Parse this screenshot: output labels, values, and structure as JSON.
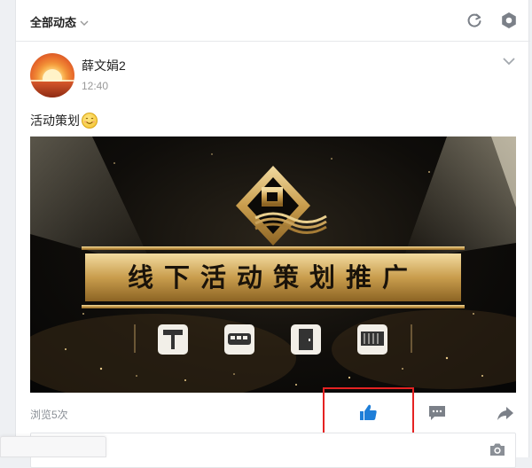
{
  "topbar": {
    "filter_label": "全部动态",
    "filter_chevron_icon": "chevron-down-icon",
    "refresh_icon": "refresh-icon",
    "settings_icon": "hexagon-gear-icon"
  },
  "post": {
    "author": "薛文娟2",
    "time": "12:40",
    "more_icon": "chevron-down-icon",
    "text": "活动策划",
    "emoji_icon": "smiley-emoji",
    "image": {
      "headline": "线下活动策划推广",
      "service_icons": [
        "billboard-icon",
        "bus-icon",
        "door-icon",
        "keyboard-icon"
      ]
    },
    "views_label": "浏览5次",
    "actions": {
      "like_icon": "thumbs-up-icon",
      "comment_icon": "comment-icon",
      "share_icon": "share-arrow-icon"
    },
    "comment_box_icon": "camera-icon"
  },
  "colors": {
    "accent_blue": "#1e7ed8",
    "highlight_red": "#e52222",
    "gold": "#d8b46a"
  }
}
